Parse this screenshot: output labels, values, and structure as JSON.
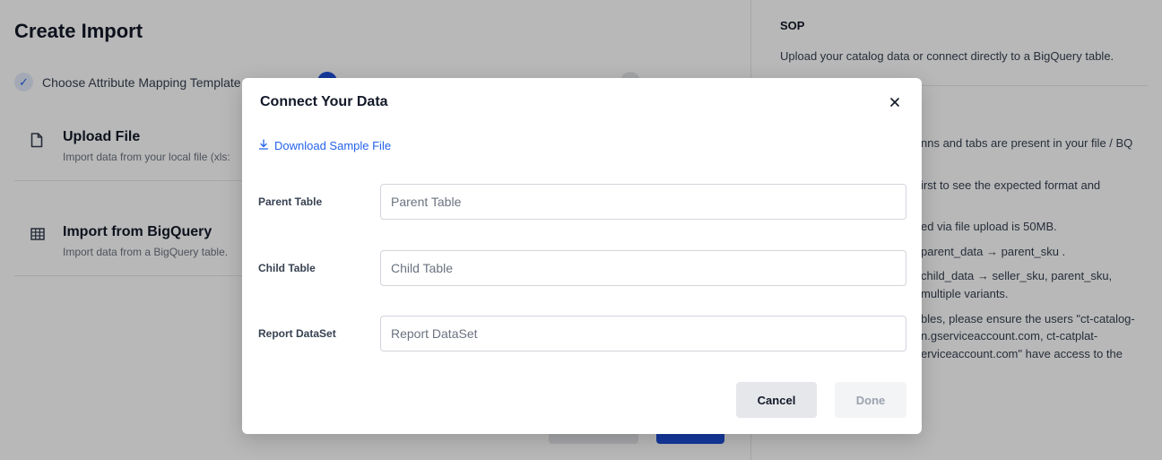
{
  "page": {
    "title": "Create Import",
    "steps": [
      {
        "label": "Choose Attribute Mapping Template",
        "state": "completed"
      },
      {
        "label": "",
        "state": "active"
      },
      {
        "label": "",
        "state": "pending"
      }
    ],
    "options": [
      {
        "title": "Upload File",
        "description": "Import data from your local file (xls:",
        "icon": "file-icon"
      },
      {
        "title": "Import from BigQuery",
        "description": "Import data from a BigQuery table.",
        "icon": "table-icon"
      }
    ]
  },
  "sop": {
    "title": "SOP",
    "intro": "Upload your catalog data or connect directly to a BigQuery table.",
    "lines": [
      "nns and tabs are present in your file / BQ",
      "irst to see the expected format and",
      "ed via file upload is 50MB.",
      "parent_data → parent_sku .",
      "child_data → seller_sku, parent_sku,",
      "multiple variants.",
      "bles, please ensure the users \"ct-catalog-",
      "n.gserviceaccount.com, ct-catplat-",
      "erviceaccount.com\" have access to the"
    ]
  },
  "modal": {
    "title": "Connect Your Data",
    "close_icon": "close-icon",
    "download_label": "Download Sample File",
    "fields": [
      {
        "label": "Parent Table",
        "placeholder": "Parent Table",
        "value": ""
      },
      {
        "label": "Child Table",
        "placeholder": "Child Table",
        "value": ""
      },
      {
        "label": "Report DataSet",
        "placeholder": "Report DataSet",
        "value": ""
      }
    ],
    "cancel_label": "Cancel",
    "done_label": "Done"
  },
  "colors": {
    "accent": "#2563eb",
    "overlay": "rgba(0,0,0,0.28)"
  }
}
